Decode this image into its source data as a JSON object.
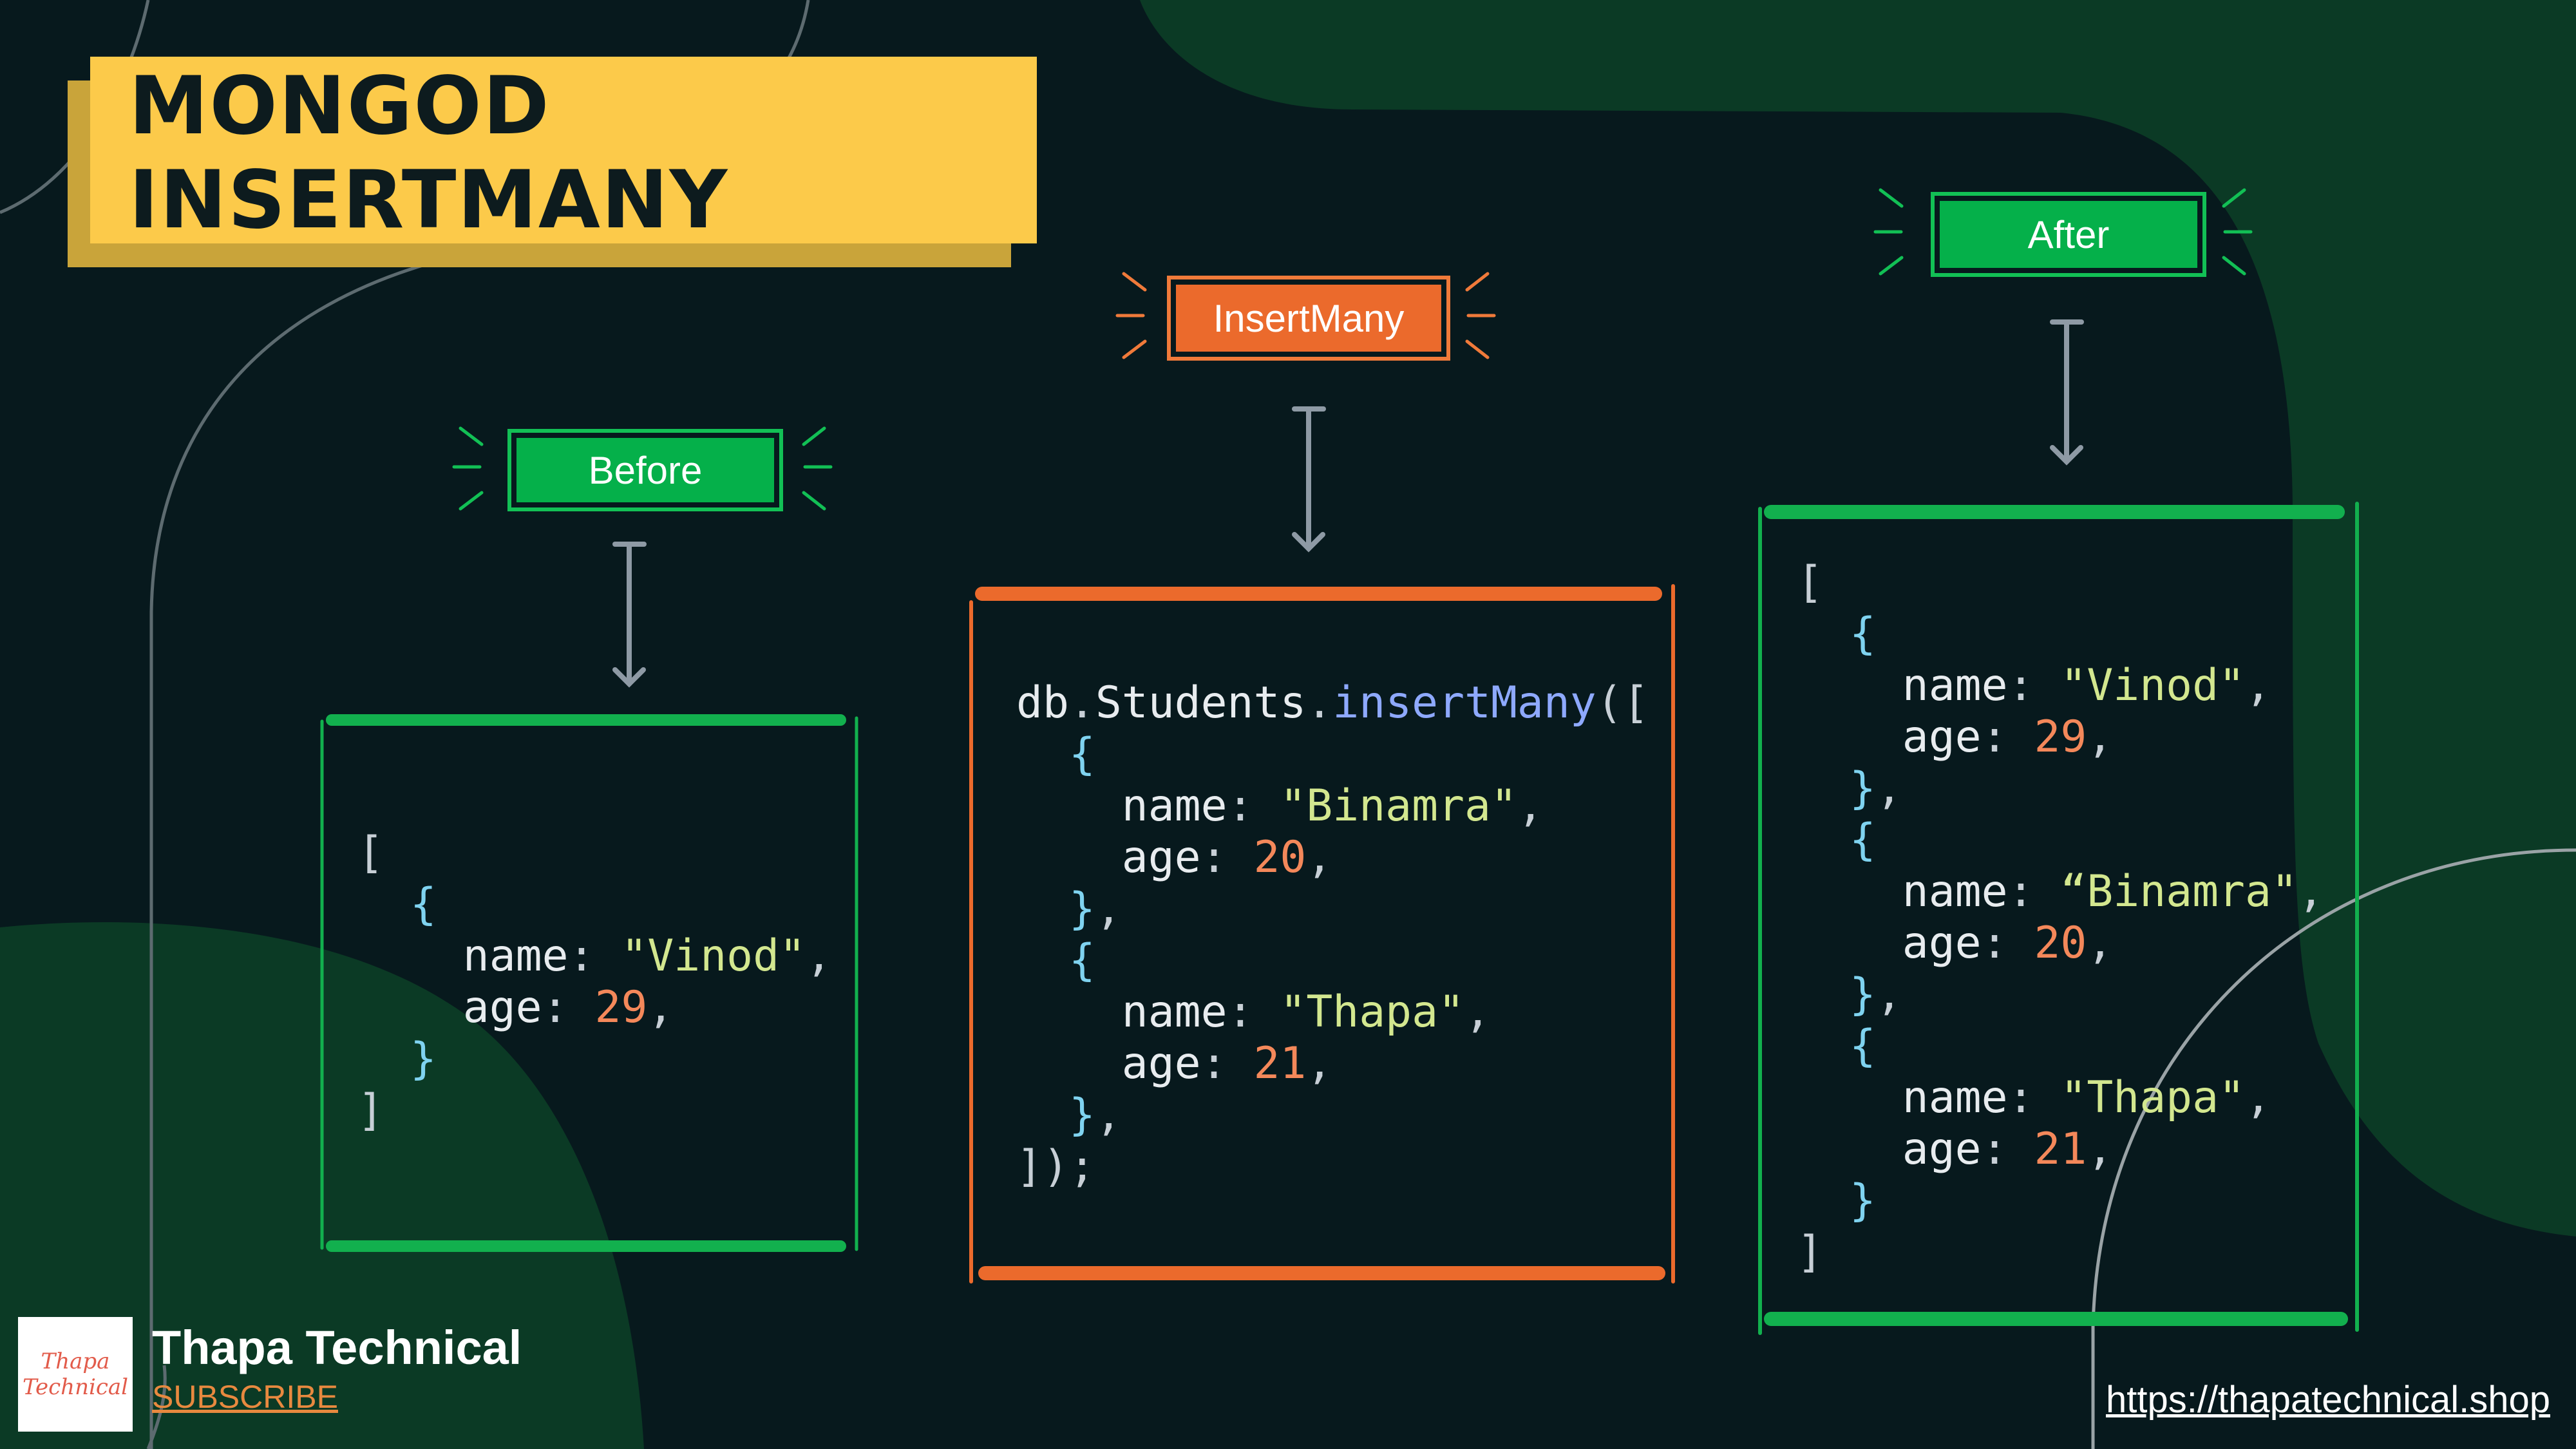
{
  "title": {
    "line1": "MONGOD",
    "line2": "INSERTMANY"
  },
  "labels": {
    "before": "Before",
    "insert_many": "InsertMany",
    "after": "After"
  },
  "before_code": {
    "open_bracket": "[",
    "open_brace": "{",
    "name_key": "name",
    "name_value": "\"Vinod\"",
    "age_key": "age",
    "age_value": "29",
    "close_brace": "}",
    "close_bracket": "]"
  },
  "insert_code": {
    "db": "db",
    "collection": "Students",
    "method": "insertMany",
    "open": "([",
    "docs": [
      {
        "name": "\"Binamra\"",
        "age": "20"
      },
      {
        "name": "\"Thapa\"",
        "age": "21"
      }
    ],
    "close": "]);"
  },
  "after_code": {
    "docs": [
      {
        "name": "\"Vinod\"",
        "age": "29"
      },
      {
        "name": "“Binamra\"",
        "age": "20"
      },
      {
        "name": "\"Thapa\"",
        "age": "21"
      }
    ]
  },
  "brand": {
    "logo_line1": "Thapa",
    "logo_line2": "Technical",
    "name": "Thapa Technical",
    "subscribe": "SUBSCRIBE"
  },
  "url": "https://thapatechnical.shop",
  "colors": {
    "background": "#07191d",
    "banner": "#fcca4a",
    "green": "#05b04a",
    "orange": "#eb6a2c",
    "blob": "#0b3a25"
  }
}
